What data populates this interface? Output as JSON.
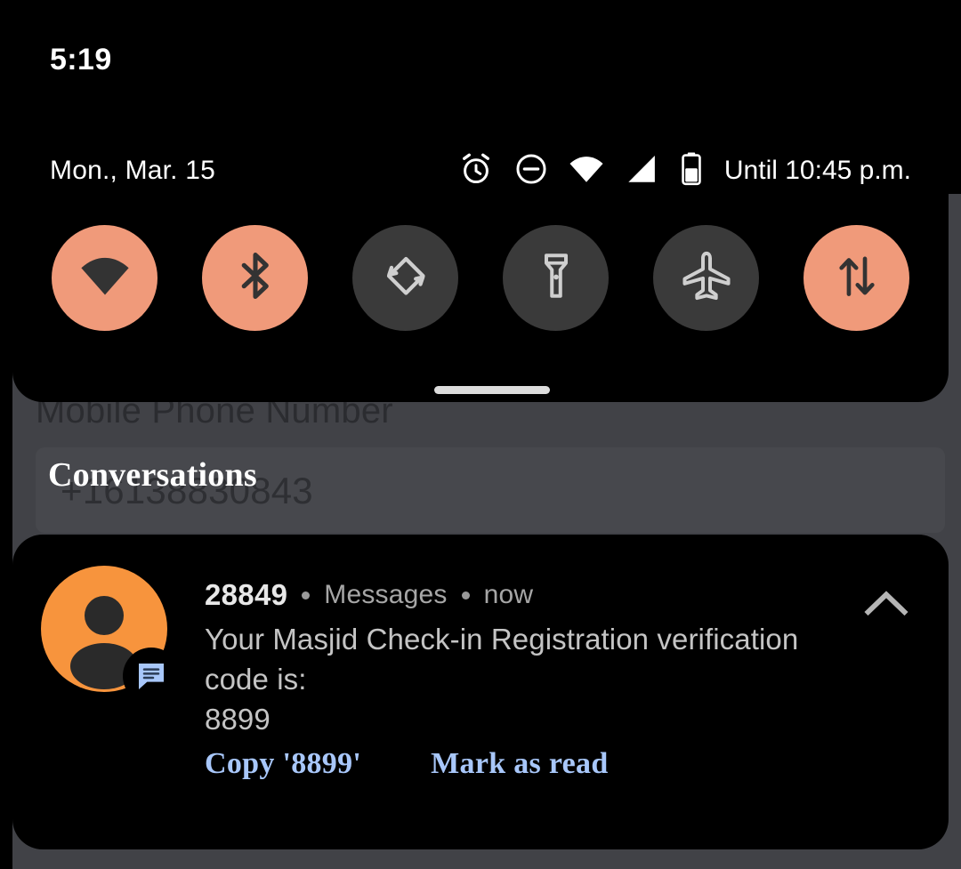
{
  "status_bar": {
    "clock": "5:19",
    "date": "Mon., Mar. 15",
    "battery_status_text": "Until 10:45 p.m.",
    "icons": [
      {
        "name": "alarm-icon",
        "label": "Alarm set"
      },
      {
        "name": "do-not-disturb-icon",
        "label": "Do not disturb"
      },
      {
        "name": "wifi-icon",
        "label": "Wi-Fi connected"
      },
      {
        "name": "cellular-signal-icon",
        "label": "Mobile signal"
      },
      {
        "name": "battery-icon",
        "label": "Battery"
      }
    ]
  },
  "quick_settings": {
    "accent_on_color": "#f09a7a",
    "tile_off_color": "#3a3a3a",
    "tiles": [
      {
        "name": "wifi-tile",
        "label": "Wi-Fi",
        "state": "on"
      },
      {
        "name": "bluetooth-tile",
        "label": "Bluetooth",
        "state": "on"
      },
      {
        "name": "auto-rotate-tile",
        "label": "Auto-rotate",
        "state": "off"
      },
      {
        "name": "flashlight-tile",
        "label": "Flashlight",
        "state": "off"
      },
      {
        "name": "airplane-mode-tile",
        "label": "Airplane mode",
        "state": "off"
      },
      {
        "name": "mobile-data-tile",
        "label": "Mobile data",
        "state": "on"
      }
    ],
    "drag_handle": "drag-handle"
  },
  "background_app": {
    "field_label": "Mobile Phone Number",
    "field_value": "+16138830843",
    "background_color": "#414247"
  },
  "notification_shade": {
    "section_header": "Conversations",
    "notification": {
      "app_name": "28849",
      "channel": "Messages",
      "time": "now",
      "body_line_1": "Your Masjid Check-in Registration verification code is:",
      "body_line_2": "8899",
      "avatar_color": "#f7943d",
      "badge_color": "#a8c7fa",
      "action_color": "#a8c7fa",
      "collapse_icon": "chevron-up-icon",
      "actions": [
        {
          "name": "copy-code-action",
          "label": "Copy '8899'"
        },
        {
          "name": "mark-as-read-action",
          "label": "Mark as read"
        }
      ]
    }
  }
}
